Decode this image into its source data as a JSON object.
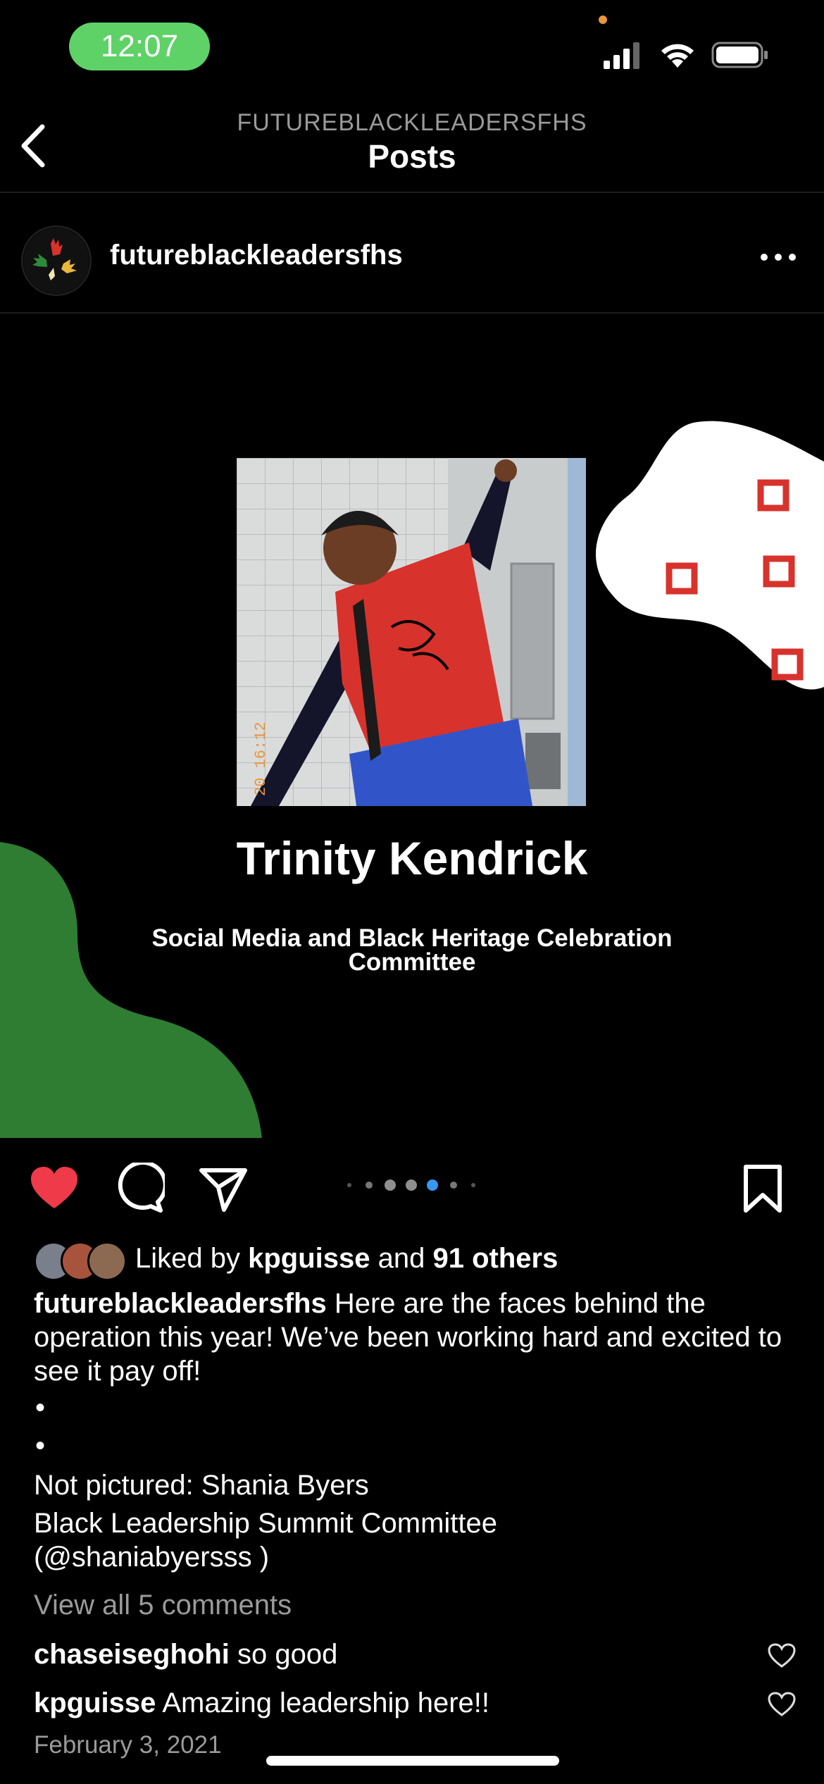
{
  "status_bar": {
    "time": "12:07"
  },
  "header": {
    "account_caption": "FUTUREBLACKLEADERSFHS",
    "title": "Posts"
  },
  "post": {
    "username": "futureblackleadersfhs",
    "person_name": "Trinity Kendrick",
    "committee": "Social Media and Black Heritage Celebration Committee",
    "photo_timestamp": "20 16:12",
    "carousel": {
      "count": 7,
      "active_index": 4
    },
    "liked": true
  },
  "likes": {
    "prefix": "Liked by",
    "user": "kpguisse",
    "connector": "and",
    "others": "91 others"
  },
  "caption": {
    "username": "futureblackleadersfhs",
    "text": "Here are the faces behind the operation this year! We’ve been working hard and excited to see it pay off!",
    "bullet1": "•",
    "bullet2": "•",
    "line1": "Not pictured: Shania Byers",
    "line2": "Black Leadership Summit Committee",
    "line3": "(@shaniabyersss )"
  },
  "view_comments": "View all 5 comments",
  "comments": [
    {
      "user": "chaseiseghohi",
      "text": "so good"
    },
    {
      "user": "kpguisse",
      "text": "Amazing leadership here!!"
    }
  ],
  "date": "February 3, 2021",
  "colors": {
    "like_red": "#ef3a4a",
    "accent_blue": "#3897f0",
    "green": "#2f7d32",
    "status_green": "#5ed267"
  }
}
